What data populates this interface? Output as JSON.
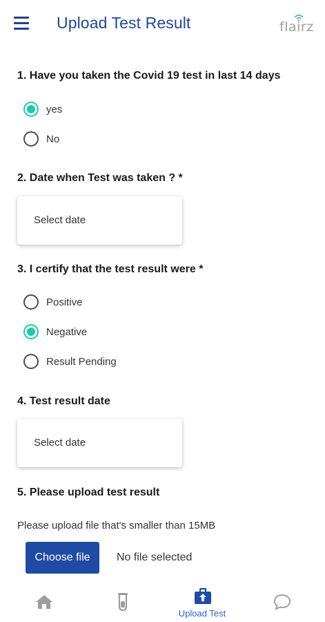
{
  "header": {
    "title": "Upload Test Result",
    "brand": "flairz",
    "menu_icon": "hamburger-icon"
  },
  "q1": {
    "label": "1. Have you taken the Covid 19 test in last 14 days",
    "options": [
      {
        "label": "yes",
        "checked": true
      },
      {
        "label": "No",
        "checked": false
      }
    ]
  },
  "q2": {
    "label": "2. Date when Test was taken ? *",
    "placeholder": "Select date"
  },
  "q3": {
    "label": "3. I certify that the test result were *",
    "options": [
      {
        "label": "Positive",
        "checked": false
      },
      {
        "label": "Negative",
        "checked": true
      },
      {
        "label": "Result Pending",
        "checked": false
      }
    ]
  },
  "q4": {
    "label": "4. Test result date",
    "placeholder": "Select date"
  },
  "q5": {
    "label": "5. Please upload test result",
    "hint": "Please upload file that's smaller than 15MB",
    "button": "Choose file",
    "status": "No file selected"
  },
  "nav": {
    "items": [
      {
        "icon": "home-icon",
        "label": "",
        "active": false
      },
      {
        "icon": "test-tube-icon",
        "label": "",
        "active": false
      },
      {
        "icon": "upload-kit-icon",
        "label": "Upload Test",
        "active": true
      },
      {
        "icon": "chat-bubble-icon",
        "label": "",
        "active": false
      }
    ]
  },
  "colors": {
    "primary": "#1f46a0",
    "accent_radio": "#1fc9a8",
    "button": "#1f4ba5",
    "nav_inactive": "#9e9e9e",
    "nav_active": "#2e63c9"
  }
}
